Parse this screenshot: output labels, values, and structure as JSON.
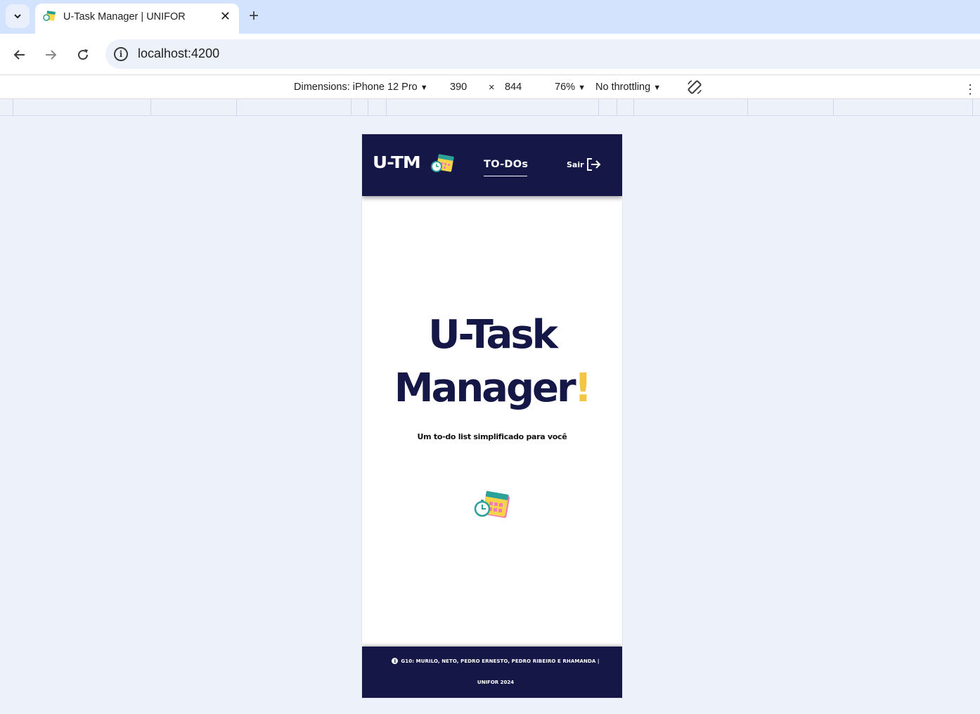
{
  "browser": {
    "tab_title": "U-Task Manager | UNIFOR",
    "url": "localhost:4200",
    "device_toolbar": {
      "dimensions_label": "Dimensions: iPhone 12 Pro",
      "width": "390",
      "times": "×",
      "height": "844",
      "zoom": "76%",
      "throttling": "No throttling"
    }
  },
  "app": {
    "brand": "U-TM",
    "nav": {
      "todos_label": "TO-DOs",
      "logout_label": "Sair"
    },
    "hero": {
      "title_line1": "U-Task",
      "title_line2": "Manager",
      "title_exclaim": "!",
      "subtitle": "Um to-do list simplificado para você"
    },
    "footer": {
      "line1": "G10: MURILO, NETO, PEDRO ERNESTO, PEDRO RIBEIRO E RHAMANDA |",
      "line2": "UNIFOR 2024"
    },
    "colors": {
      "navy": "#151846",
      "accent_yellow": "#f4c542"
    }
  },
  "icons": [
    "tab-search-icon",
    "favicon-calendar-icon",
    "close-icon",
    "plus-icon",
    "back-arrow-icon",
    "forward-arrow-icon",
    "reload-icon",
    "info-icon",
    "rotate-icon",
    "more-vert-icon",
    "calendar-clock-icon",
    "logout-icon"
  ]
}
